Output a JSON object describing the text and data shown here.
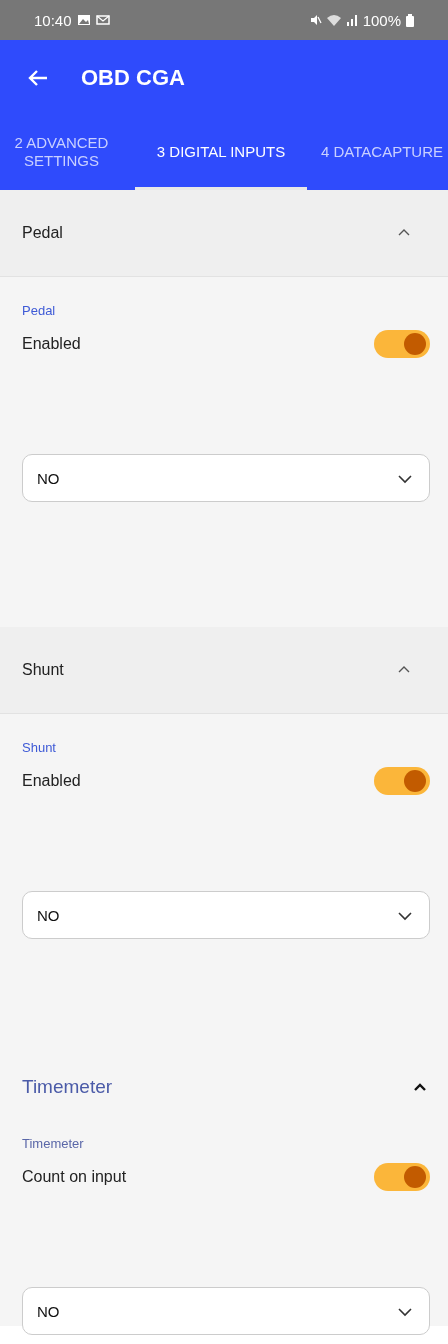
{
  "status_bar": {
    "time": "10:40",
    "battery": "100%"
  },
  "app_bar": {
    "title": "OBD CGA"
  },
  "tabs": [
    {
      "label": "2 ADVANCED SETTINGS",
      "selected": false
    },
    {
      "label": "3 DIGITAL INPUTS",
      "selected": true
    },
    {
      "label": "4 DATACAPTURE",
      "selected": false
    }
  ],
  "sections": [
    {
      "kind": "panel",
      "title": "Pedal",
      "expanded": true,
      "group_label": "Pedal",
      "switch_label": "Enabled",
      "on": true,
      "dropdown": "NO"
    },
    {
      "kind": "panel",
      "title": "Shunt",
      "expanded": true,
      "group_label": "Shunt",
      "switch_label": "Enabled",
      "on": true,
      "dropdown": "NO"
    },
    {
      "kind": "heading",
      "title": "Timemeter",
      "expanded": true,
      "group_label": "Timemeter",
      "switch_label": "Count on input",
      "on": true,
      "dropdown": "NO"
    }
  ]
}
